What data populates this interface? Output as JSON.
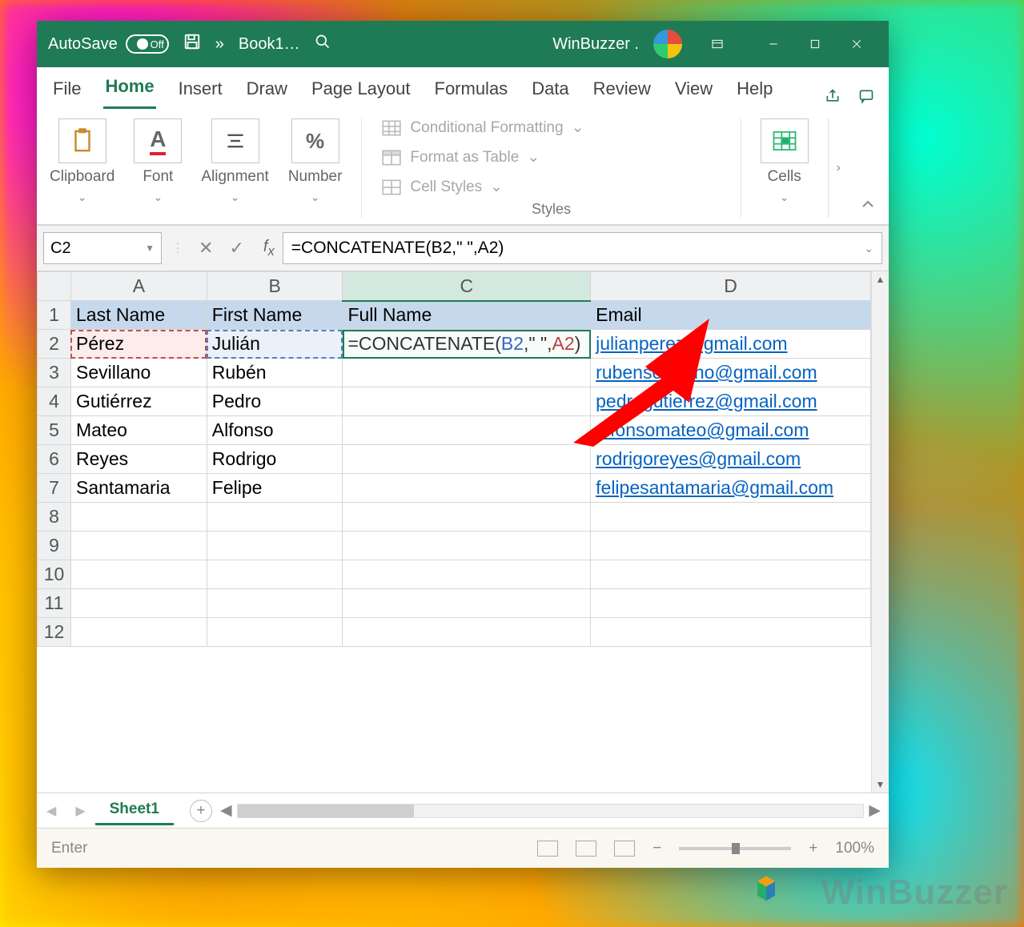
{
  "titlebar": {
    "autosave_label": "AutoSave",
    "autosave_state": "Off",
    "overflow": "»",
    "doc_title": "Book1…",
    "user_label": "WinBuzzer ."
  },
  "tabs": [
    "File",
    "Home",
    "Insert",
    "Draw",
    "Page Layout",
    "Formulas",
    "Data",
    "Review",
    "View",
    "Help"
  ],
  "active_tab": "Home",
  "ribbon": {
    "groups": {
      "clipboard": "Clipboard",
      "font": "Font",
      "alignment": "Alignment",
      "number": "Number",
      "cells": "Cells"
    },
    "styles": {
      "cond": "Conditional Formatting",
      "table": "Format as Table",
      "cell": "Cell Styles",
      "group_label": "Styles"
    }
  },
  "namebox": "C2",
  "formula": {
    "raw": "=CONCATENATE(B2,\" \",A2)",
    "prefix": "=CONCATENATE(",
    "b2": "B2",
    "mid": ",\" \",",
    "a2": "A2",
    "suffix": ")"
  },
  "columns": [
    "A",
    "B",
    "C",
    "D"
  ],
  "headers": {
    "A": "Last Name",
    "B": "First Name",
    "C": "Full Name",
    "D": "Email"
  },
  "rows": [
    {
      "n": "1"
    },
    {
      "n": "2",
      "A": "Pérez",
      "B": "Julián",
      "D": "julianperez@gmail.com"
    },
    {
      "n": "3",
      "A": "Sevillano",
      "B": "Rubén",
      "D": "rubensevillano@gmail.com"
    },
    {
      "n": "4",
      "A": "Gutiérrez",
      "B": "Pedro",
      "D": "pedrogutierrez@gmail.com"
    },
    {
      "n": "5",
      "A": "Mateo",
      "B": "Alfonso",
      "D": "alfonsomateo@gmail.com"
    },
    {
      "n": "6",
      "A": "Reyes",
      "B": "Rodrigo",
      "D": "rodrigoreyes@gmail.com"
    },
    {
      "n": "7",
      "A": "Santamaria",
      "B": "Felipe",
      "D": "felipesantamaria@gmail.com"
    },
    {
      "n": "8"
    },
    {
      "n": "9"
    },
    {
      "n": "10"
    },
    {
      "n": "11"
    },
    {
      "n": "12"
    }
  ],
  "sheet_tab": "Sheet1",
  "status": {
    "mode": "Enter",
    "zoom": "100%"
  },
  "watermark": "WinBuzzer"
}
